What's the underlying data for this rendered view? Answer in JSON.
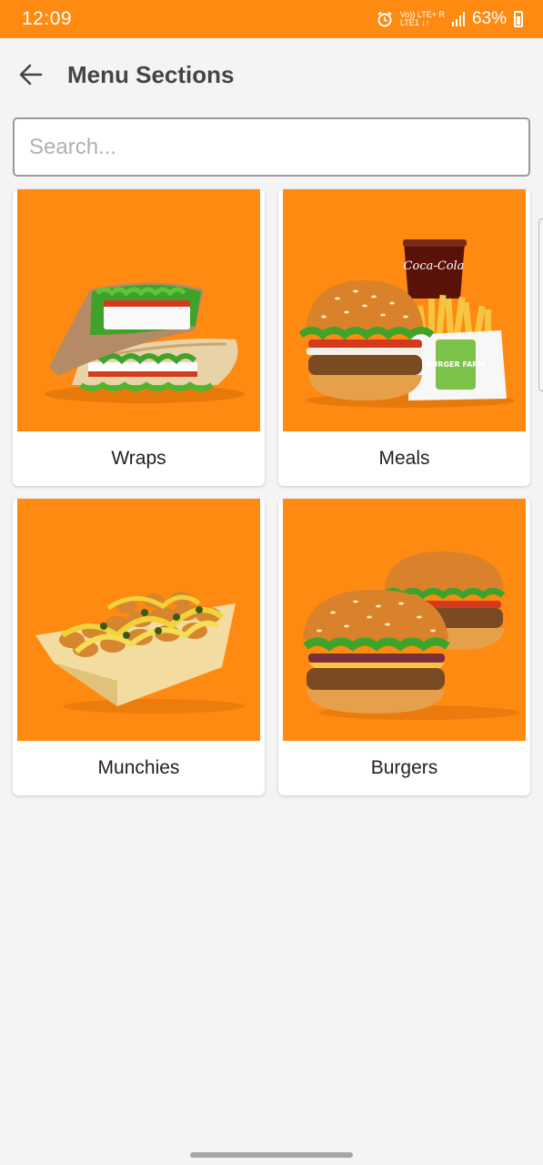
{
  "status_bar": {
    "time": "12:09",
    "network_line1": "Vo)) LTE+ R",
    "network_line2": "LTE1 ↓↑",
    "battery": "63%"
  },
  "header": {
    "title": "Menu Sections",
    "back_icon": "arrow-left-icon"
  },
  "search": {
    "placeholder": "Search...",
    "value": ""
  },
  "sections": [
    {
      "label": "Wraps"
    },
    {
      "label": "Meals"
    },
    {
      "label": "Munchies"
    },
    {
      "label": "Burgers"
    }
  ],
  "image_text": {
    "cola_brand": "Coca-Cola",
    "fries_brand": "BURGER FARM"
  },
  "colors": {
    "accent": "#ff8a12",
    "background": "#f4f4f4"
  }
}
